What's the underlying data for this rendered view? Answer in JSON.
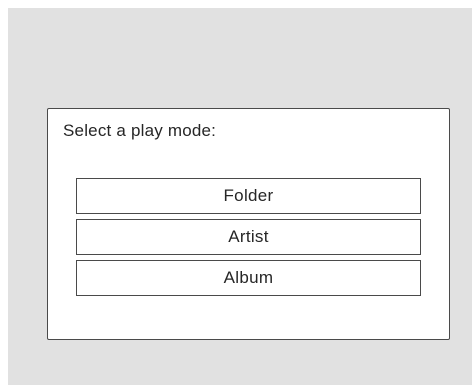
{
  "dialog": {
    "prompt": "Select a play mode:",
    "options": [
      {
        "label": "Folder"
      },
      {
        "label": "Artist"
      },
      {
        "label": "Album"
      }
    ]
  },
  "colors": {
    "screen_background": "#e1e1e1",
    "dialog_background": "#ffffff",
    "border": "#4a4a4a",
    "text": "#262626"
  }
}
